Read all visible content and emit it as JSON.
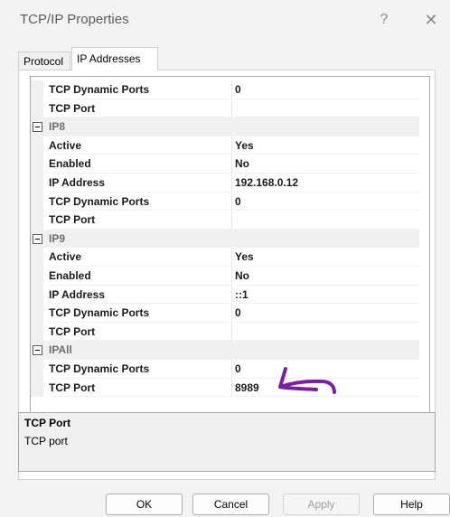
{
  "window": {
    "title": "TCP/IP Properties",
    "help_glyph": "?",
    "close_glyph": "✕"
  },
  "tabs": [
    {
      "label": "Protocol",
      "active": false
    },
    {
      "label": "IP Addresses",
      "active": true
    }
  ],
  "grid": {
    "rows": [
      {
        "type": "prop",
        "name": "TCP Dynamic Ports",
        "value": "0"
      },
      {
        "type": "prop",
        "name": "TCP Port",
        "value": ""
      },
      {
        "type": "group",
        "name": "IP8"
      },
      {
        "type": "prop",
        "name": "Active",
        "value": "Yes"
      },
      {
        "type": "prop",
        "name": "Enabled",
        "value": "No"
      },
      {
        "type": "prop",
        "name": "IP Address",
        "value": "192.168.0.12"
      },
      {
        "type": "prop",
        "name": "TCP Dynamic Ports",
        "value": "0"
      },
      {
        "type": "prop",
        "name": "TCP Port",
        "value": ""
      },
      {
        "type": "group",
        "name": "IP9"
      },
      {
        "type": "prop",
        "name": "Active",
        "value": "Yes"
      },
      {
        "type": "prop",
        "name": "Enabled",
        "value": "No"
      },
      {
        "type": "prop",
        "name": "IP Address",
        "value": "::1"
      },
      {
        "type": "prop",
        "name": "TCP Dynamic Ports",
        "value": "0"
      },
      {
        "type": "prop",
        "name": "TCP Port",
        "value": ""
      },
      {
        "type": "group",
        "name": "IPAll"
      },
      {
        "type": "prop",
        "name": "TCP Dynamic Ports",
        "value": "0"
      },
      {
        "type": "prop",
        "name": "TCP Port",
        "value": "8989"
      }
    ]
  },
  "description": {
    "title": "TCP Port",
    "text": "TCP port"
  },
  "buttons": {
    "ok": "OK",
    "cancel": "Cancel",
    "apply": "Apply",
    "help": "Help"
  },
  "annotation": {
    "color": "#7a1fa2"
  }
}
